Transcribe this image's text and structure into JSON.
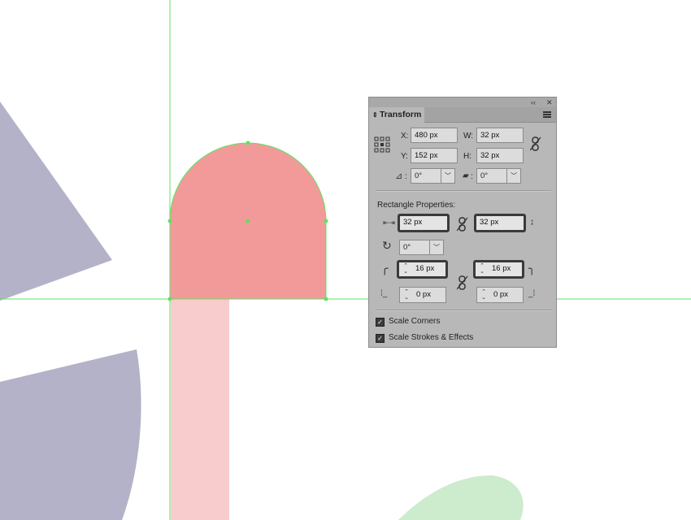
{
  "colors": {
    "guide": "#5de35d",
    "cap_fill": "#f29a9a",
    "stem_fill": "#f8cccc",
    "blob_lavender": "#b3b2c8",
    "blob_green": "#cdebcd"
  },
  "panel": {
    "collapse_glyph": "‹‹",
    "close_glyph": "✕",
    "tab_label": "Transform",
    "x_label": "X:",
    "x_value": "480 px",
    "y_label": "Y:",
    "y_value": "152 px",
    "w_label": "W:",
    "w_value": "32 px",
    "h_label": "H:",
    "h_value": "32 px",
    "rotate_value": "0°",
    "shear_value": "0°",
    "rect_title": "Rectangle Properties:",
    "rect_width": "32 px",
    "rect_height": "32 px",
    "rect_rotate": "0°",
    "corner_tl": "16 px",
    "corner_tr": "16 px",
    "corner_bl": "0 px",
    "corner_br": "0 px",
    "scale_corners_label": "Scale Corners",
    "scale_strokes_label": "Scale Strokes & Effects",
    "scale_corners_checked": true,
    "scale_strokes_checked": true
  }
}
